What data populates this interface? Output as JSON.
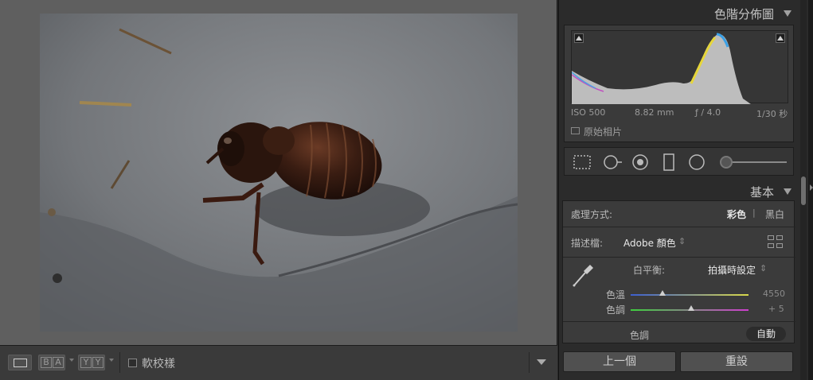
{
  "toolbar": {
    "softproof_label": "軟校樣"
  },
  "histogram": {
    "title": "色階分佈圖",
    "exif": {
      "iso": "ISO 500",
      "focal_length": "8.82 mm",
      "aperture": "ƒ / 4.0",
      "shutter": "1/30 秒"
    },
    "original_photo_label": "原始相片"
  },
  "basic": {
    "title": "基本",
    "treatment_label": "處理方式:",
    "treatment_color": "彩色",
    "treatment_separator": "|",
    "treatment_bw": "黑白",
    "profile_label": "描述檔:",
    "profile_value": "Adobe 顏色",
    "wb_label": "白平衡:",
    "wb_value": "拍攝時設定",
    "temp_label": "色溫",
    "temp_value": "4550",
    "tint_label": "色調",
    "tint_value": "+ 5",
    "tone_label": "色調",
    "auto_label": "自動"
  },
  "buttons": {
    "previous": "上一個",
    "reset": "重設"
  },
  "colors": {
    "panel_bg": "#2b2b2b",
    "photo_bg": "#5f5f5f",
    "temp_slider": [
      "#3c5fd0",
      "#d8d84a"
    ],
    "tint_slider": [
      "#3ecf3e",
      "#cf3ecf"
    ]
  }
}
